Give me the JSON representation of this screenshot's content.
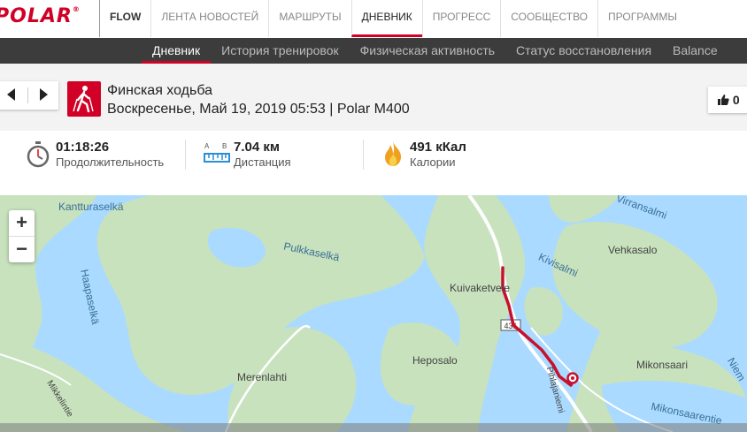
{
  "brand": {
    "logo": "POLAR",
    "logo_mark": "®",
    "accent_color": "#d10027"
  },
  "nav": {
    "flow": "FLOW",
    "items": [
      {
        "label": "ЛЕНТА НОВОСТЕЙ"
      },
      {
        "label": "МАРШРУТЫ"
      },
      {
        "label": "ДНЕВНИК",
        "active": true
      },
      {
        "label": "ПРОГРЕСС"
      },
      {
        "label": "СООБЩЕСТВО"
      },
      {
        "label": "ПРОГРАММЫ"
      }
    ]
  },
  "subnav": {
    "items": [
      {
        "label": "Дневник",
        "active": true
      },
      {
        "label": "История тренировок"
      },
      {
        "label": "Физическая активность"
      },
      {
        "label": "Статус восстановления"
      },
      {
        "label": "Balance"
      }
    ]
  },
  "session": {
    "sport": "Финская ходьба",
    "meta": "Воскресенье, Май 19, 2019 05:53 | Polar M400",
    "sport_icon": "nordic-walking-icon",
    "likes": "0"
  },
  "stats": {
    "duration": {
      "value": "01:18:26",
      "label": "Продолжительность",
      "icon": "stopwatch-icon"
    },
    "distance": {
      "value": "7.04 км",
      "label": "Дистанция",
      "icon": "distance-icon",
      "icon_a": "A",
      "icon_b": "B"
    },
    "calories": {
      "value": "491 кКал",
      "label": "Калории",
      "icon": "flame-icon"
    }
  },
  "map": {
    "zoom_in": "+",
    "zoom_out": "−",
    "road_number": "431",
    "labels": {
      "kantturaselka": "Kantturaselkä",
      "virransalmi": "Virransalmi",
      "vehkasalo": "Vehkasalo",
      "pulkkaselka": "Pulkkaselkä",
      "kivisalmi": "Kivisalmi",
      "kuivaketvele": "Kuivaketvele",
      "haapaselka": "Haapaselkä",
      "heposalo": "Heposalo",
      "mikonsaari": "Mikonsaari",
      "merenlahti": "Merenlahti",
      "mikkelintie": "Mikkelintie",
      "mikonsaarenti": "Mikonsaarentie",
      "pihlajaniemi": "Pihlajaniemi",
      "niemi": "Niem"
    }
  }
}
